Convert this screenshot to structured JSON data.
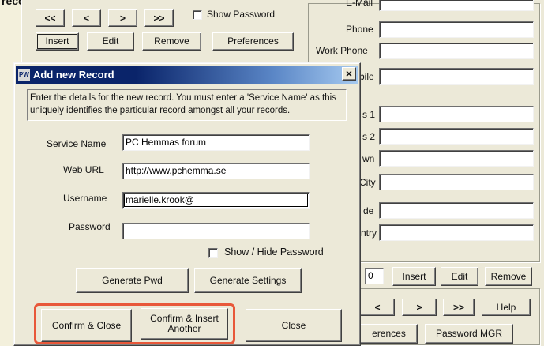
{
  "caption_top": "records.",
  "main": {
    "nav_first": "<<",
    "nav_prev": "<",
    "nav_next": ">",
    "nav_last": ">>",
    "show_password_label": "Show Password",
    "insert_label": "Insert",
    "edit_label": "Edit",
    "remove_label": "Remove",
    "preferences_label": "Preferences"
  },
  "right_panel": {
    "email_label": "E-Mail",
    "phone_label": "Phone",
    "work_phone_label": "Work Phone",
    "mobile_label": "bile",
    "address1_label": "s 1",
    "address2_label": "s 2",
    "town_label": "wn",
    "city_label": "City",
    "postcode_label": "de",
    "country_label": "ntry",
    "index_value": "0",
    "insert_label": "Insert",
    "edit_label": "Edit",
    "remove_label": "Remove",
    "nav_prev": "<",
    "nav_next": ">",
    "nav_last": ">>",
    "help_label": "Help",
    "preferences_label": "erences",
    "password_mgr_label": "Password MGR"
  },
  "dialog": {
    "title": "Add new Record",
    "app_icon_label": "PW",
    "close_glyph": "×",
    "instructions": "Enter the details for the new record. You must enter a 'Service Name' as this uniquely identifies the particular record amongst all your records.",
    "service_name_label": "Service Name",
    "service_name_value": "PC Hemmas forum",
    "web_url_label": "Web URL",
    "web_url_value": "http://www.pchemma.se",
    "username_label": "Username",
    "username_value": "marielle.krook@",
    "password_label": "Password",
    "password_value": "",
    "show_hide_label": "Show / Hide  Password",
    "generate_pwd_label": "Generate Pwd",
    "generate_settings_label": "Generate Settings",
    "confirm_close_label": "Confirm & Close",
    "confirm_insert_label": "Confirm & Insert Another",
    "close_label": "Close"
  },
  "colors": {
    "titlebar_start": "#0a246a",
    "titlebar_end": "#a6caf0",
    "highlight": "#e8583a",
    "button_face": "#ece9d8"
  }
}
